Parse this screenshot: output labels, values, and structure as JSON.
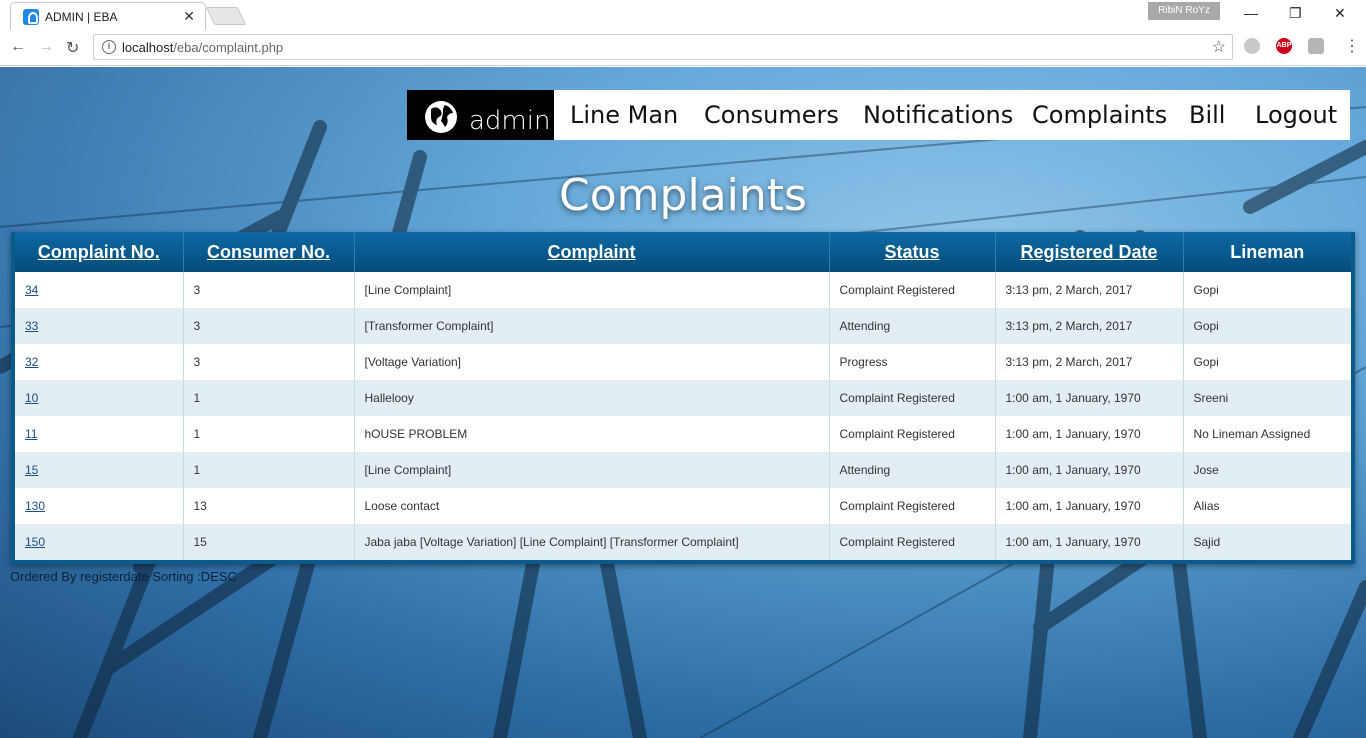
{
  "browser": {
    "tab_title": "ADMIN | EBA",
    "tab_close": "✕",
    "profile_name": "RibiN RoYz",
    "url_host": "localhost",
    "url_path": "/eba/complaint.php"
  },
  "nav": {
    "brand": "admin",
    "items": [
      "Line Man",
      "Consumers",
      "Notifications",
      "Complaints",
      "Bill",
      "Logout"
    ]
  },
  "page_title": "Complaints",
  "table": {
    "headers": [
      "Complaint No.",
      "Consumer No.",
      "Complaint",
      "Status",
      "Registered Date",
      "Lineman"
    ],
    "rows": [
      [
        "34",
        "3",
        "[Line Complaint]",
        "Complaint Registered",
        "3:13 pm, 2 March, 2017",
        "Gopi"
      ],
      [
        "33",
        "3",
        "[Transformer Complaint]",
        "Attending",
        "3:13 pm, 2 March, 2017",
        "Gopi"
      ],
      [
        "32",
        "3",
        "[Voltage Variation]",
        "Progress",
        "3:13 pm, 2 March, 2017",
        "Gopi"
      ],
      [
        "10",
        "1",
        "Hallelooy",
        "Complaint Registered",
        "1:00 am, 1 January, 1970",
        "Sreeni"
      ],
      [
        "11",
        "1",
        "hOUSE PROBLEM",
        "Complaint Registered",
        "1:00 am, 1 January, 1970",
        "No Lineman Assigned"
      ],
      [
        "15",
        "1",
        "[Line Complaint]",
        "Attending",
        "1:00 am, 1 January, 1970",
        "Jose"
      ],
      [
        "130",
        "13",
        "Loose contact",
        "Complaint Registered",
        "1:00 am, 1 January, 1970",
        "Alias"
      ],
      [
        "150",
        "15",
        "Jaba jaba [Voltage Variation] [Line Complaint] [Transformer Complaint]",
        "Complaint Registered",
        "1:00 am, 1 January, 1970",
        "Sajid"
      ]
    ]
  },
  "footer_note": "Ordered By registerdate Sorting :DESC"
}
